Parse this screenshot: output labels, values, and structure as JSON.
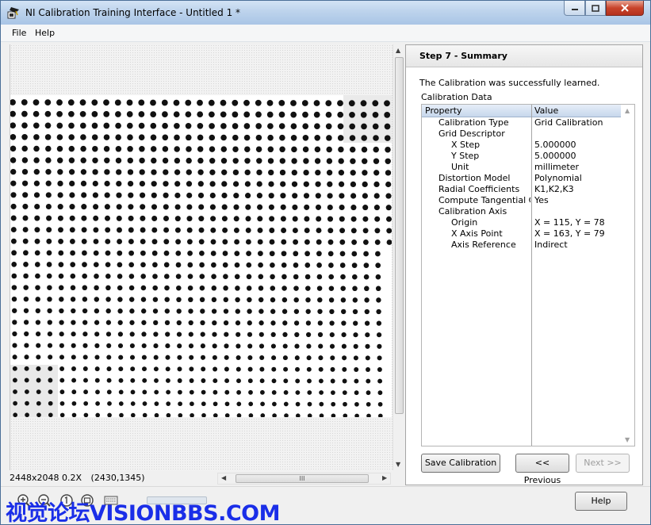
{
  "window": {
    "title": "NI Calibration Training Interface - Untitled 1 *"
  },
  "menu": {
    "file": "File",
    "help": "Help"
  },
  "image_status": {
    "info": "2448x2048 0.2X",
    "coords": "(2430,1345)"
  },
  "panel": {
    "step_title": "Step 7 - Summary",
    "success_message": "The Calibration was successfully learned.",
    "calibration_data_label": "Calibration Data",
    "table": {
      "headers": [
        "Property",
        "Value"
      ],
      "rows": [
        {
          "property": "Calibration Type",
          "value": "Grid Calibration",
          "level": 1
        },
        {
          "property": "Grid Descriptor",
          "value": "",
          "level": 1
        },
        {
          "property": "X Step",
          "value": "5.000000",
          "level": 2
        },
        {
          "property": "Y Step",
          "value": "5.000000",
          "level": 2
        },
        {
          "property": "Unit",
          "value": "millimeter",
          "level": 2
        },
        {
          "property": "Distortion Model",
          "value": "Polynomial",
          "level": 1
        },
        {
          "property": "Radial Coefficients",
          "value": "K1,K2,K3",
          "level": 1
        },
        {
          "property": "Compute Tangential Coe",
          "value": "Yes",
          "level": 1
        },
        {
          "property": "Calibration Axis",
          "value": "",
          "level": 1
        },
        {
          "property": "Origin",
          "value": "X = 115, Y = 78",
          "level": 2
        },
        {
          "property": "X Axis Point",
          "value": "X = 163, Y = 79",
          "level": 2
        },
        {
          "property": "Axis Reference",
          "value": "Indirect",
          "level": 2
        }
      ]
    }
  },
  "buttons": {
    "save": "Save Calibration",
    "previous": "<< Previous",
    "next": "Next >>",
    "help": "Help"
  },
  "hscroll_grip": "III",
  "watermark": "视觉论坛VISIONBBS.COM",
  "icons": {
    "app": "app-icon",
    "zoom_in": "zoom-in-icon",
    "zoom_out": "zoom-out-icon",
    "zoom_1to1": "zoom-1to1-icon",
    "zoom_fit": "zoom-fit-icon",
    "keyboard": "keyboard-icon"
  },
  "colors": {
    "watermark": "#1a2ee8",
    "close_button": "#c8432b",
    "table_header": "#c7d7ec"
  }
}
